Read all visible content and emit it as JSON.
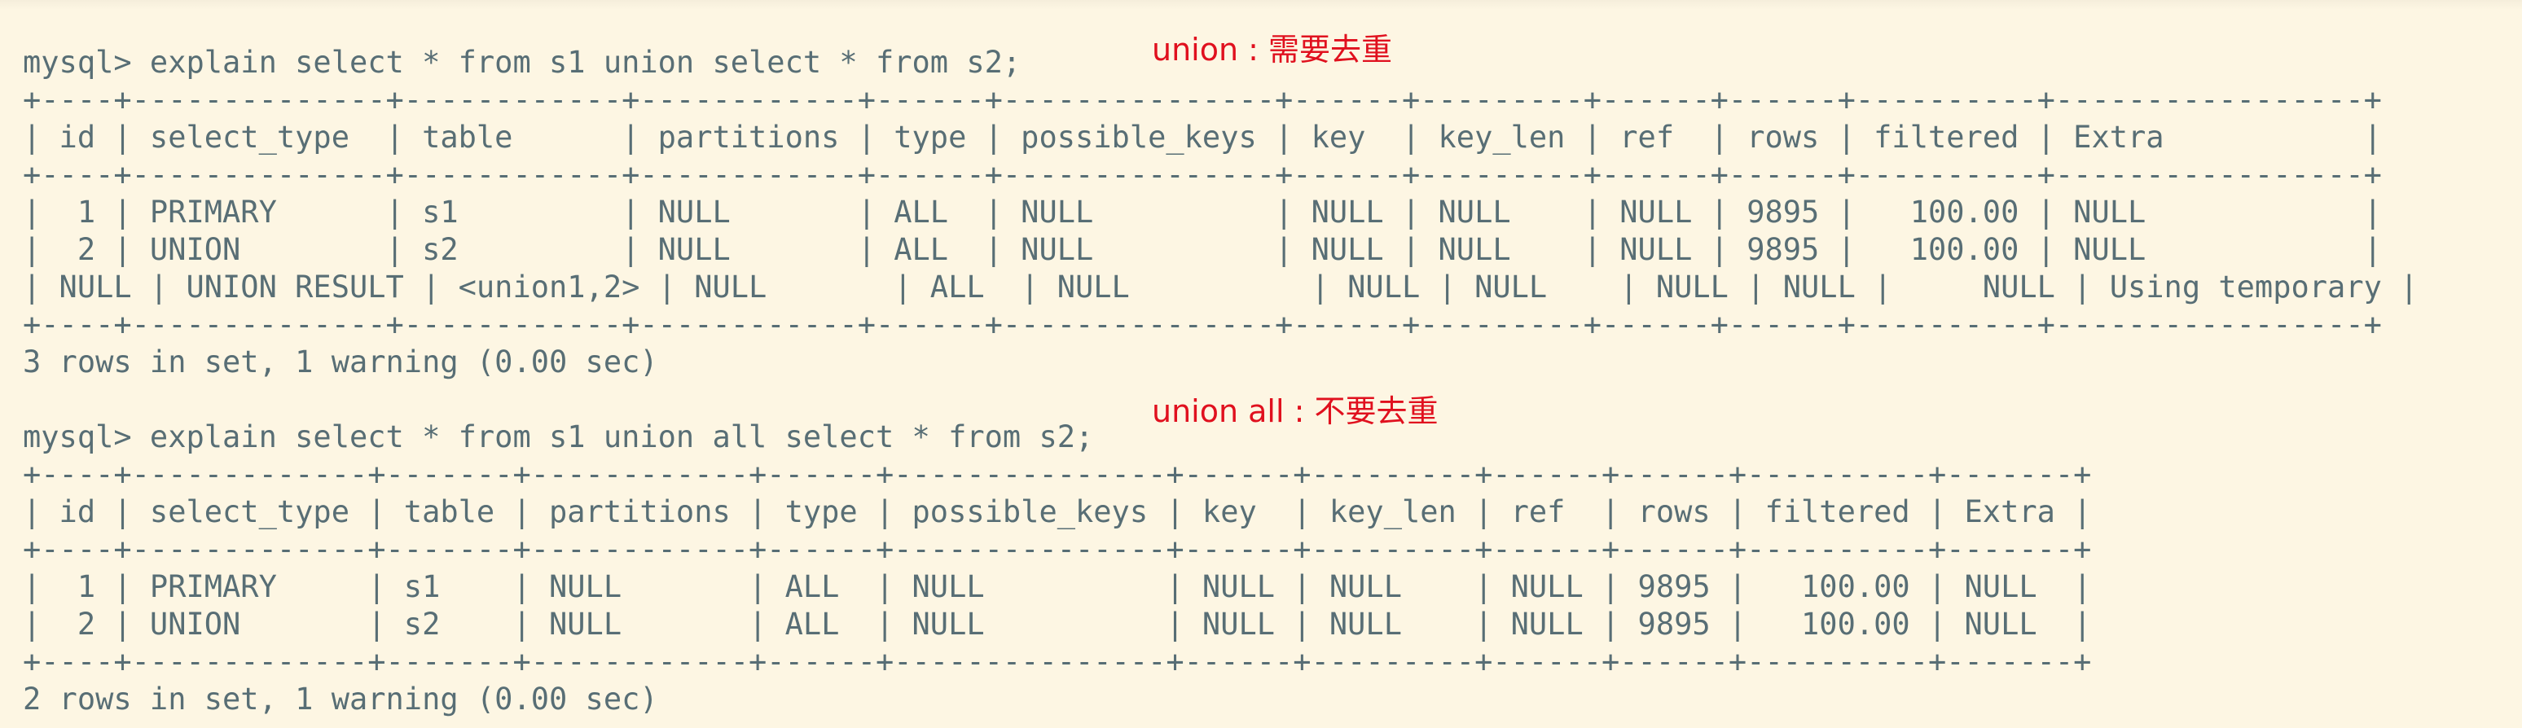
{
  "section1": {
    "command": "mysql> explain select * from s1 union select * from s2;",
    "annotation": "union : 需要去重",
    "table_lines": [
      "+----+--------------+------------+------------+------+---------------+------+---------+------+------+----------+-----------------+",
      "| id | select_type  | table      | partitions | type | possible_keys | key  | key_len | ref  | rows | filtered | Extra           |",
      "+----+--------------+------------+------------+------+---------------+------+---------+------+------+----------+-----------------+",
      "|  1 | PRIMARY      | s1         | NULL       | ALL  | NULL          | NULL | NULL    | NULL | 9895 |   100.00 | NULL            |",
      "|  2 | UNION        | s2         | NULL       | ALL  | NULL          | NULL | NULL    | NULL | 9895 |   100.00 | NULL            |",
      "| NULL | UNION RESULT | <union1,2> | NULL       | ALL  | NULL          | NULL | NULL    | NULL | NULL |     NULL | Using temporary |",
      "+----+--------------+------------+------------+------+---------------+------+---------+------+------+----------+-----------------+"
    ],
    "status": "3 rows in set, 1 warning (0.00 sec)"
  },
  "section2": {
    "command": "mysql> explain select * from s1 union all select * from s2;",
    "annotation": "union all : 不要去重",
    "table_lines": [
      "+----+-------------+-------+------------+------+---------------+------+---------+------+------+----------+-------+",
      "| id | select_type | table | partitions | type | possible_keys | key  | key_len | ref  | rows | filtered | Extra |",
      "+----+-------------+-------+------------+------+---------------+------+---------+------+------+----------+-------+",
      "|  1 | PRIMARY     | s1    | NULL       | ALL  | NULL          | NULL | NULL    | NULL | 9895 |   100.00 | NULL  |",
      "|  2 | UNION       | s2    | NULL       | ALL  | NULL          | NULL | NULL    | NULL | 9895 |   100.00 | NULL  |",
      "+----+-------------+-------+------------+------+---------------+------+---------+------+------+----------+-------+"
    ],
    "status": "2 rows in set, 1 warning (0.00 sec)"
  },
  "colors": {
    "background": "#fdf6e3",
    "text": "#586e75",
    "annotation": "#e0101e"
  }
}
